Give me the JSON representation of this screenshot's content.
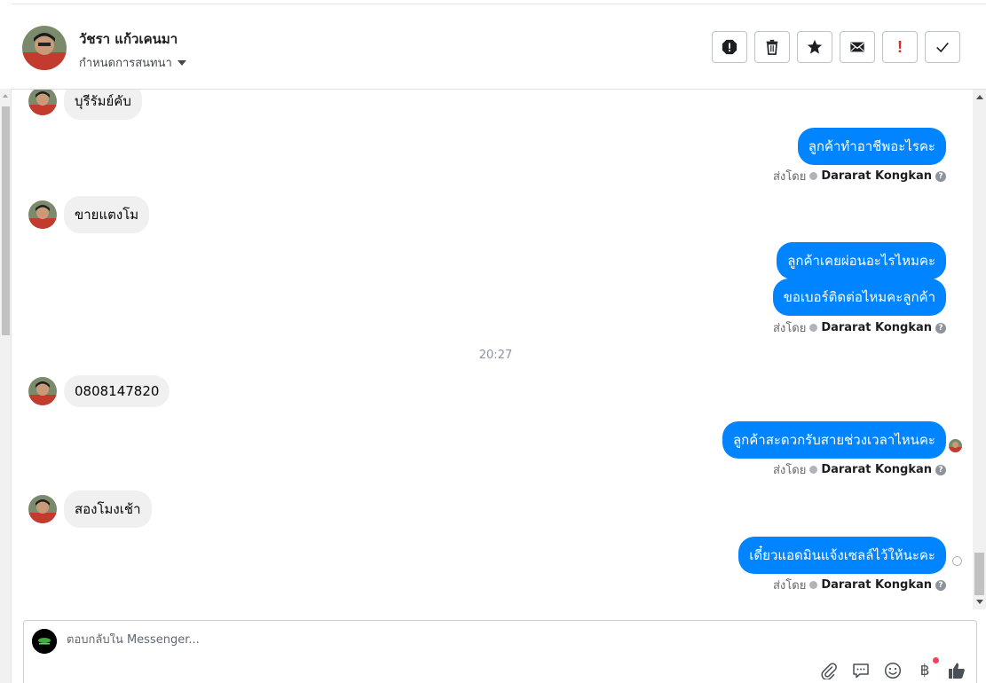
{
  "header": {
    "contact_name": "วัชรา แก้วเคนมา",
    "assign_label": "กำหนดการสนทนา",
    "actions": [
      {
        "name": "spam-icon",
        "label": "spam"
      },
      {
        "name": "trash-icon",
        "label": "delete"
      },
      {
        "name": "star-icon",
        "label": "star"
      },
      {
        "name": "envelope-icon",
        "label": "mark unread"
      },
      {
        "name": "exclamation-icon",
        "label": "!"
      },
      {
        "name": "checkmark-icon",
        "label": "done"
      }
    ],
    "important_glyph": "!"
  },
  "messages": {
    "m1": "บุรีรัมย์คับ",
    "m2": "ลูกค้าทำอาชีพอะไรคะ",
    "m3": "ขายแตงโม",
    "m4": "ลูกค้าเคยผ่อนอะไรไหมคะ",
    "m5": "ขอเบอร์ติดต่อไหมคะลูกค้า",
    "time": "20:27",
    "m6": "0808147820",
    "m7": "ลูกค้าสะดวกรับสายช่วงเวลาไหนคะ",
    "m8": "สองโมงเช้า",
    "m9": "เดี๋ยวแอดมินแจ้งเซลล์ไว้ให้นะคะ"
  },
  "sent_by": {
    "prefix": "ส่งโดย",
    "agent": "Dararat Kongkan",
    "help": "?"
  },
  "composer": {
    "placeholder": "ตอบกลับใน Messenger...",
    "tools": [
      "paperclip-icon",
      "saved-replies-icon",
      "emoji-icon",
      "baht-payment-icon",
      "thumbs-up-icon"
    ],
    "baht_symbol": "฿"
  },
  "colors": {
    "outgoing_bubble": "#0084ff",
    "incoming_bubble": "#f0f0f0",
    "badge": "#fa3e5e"
  }
}
